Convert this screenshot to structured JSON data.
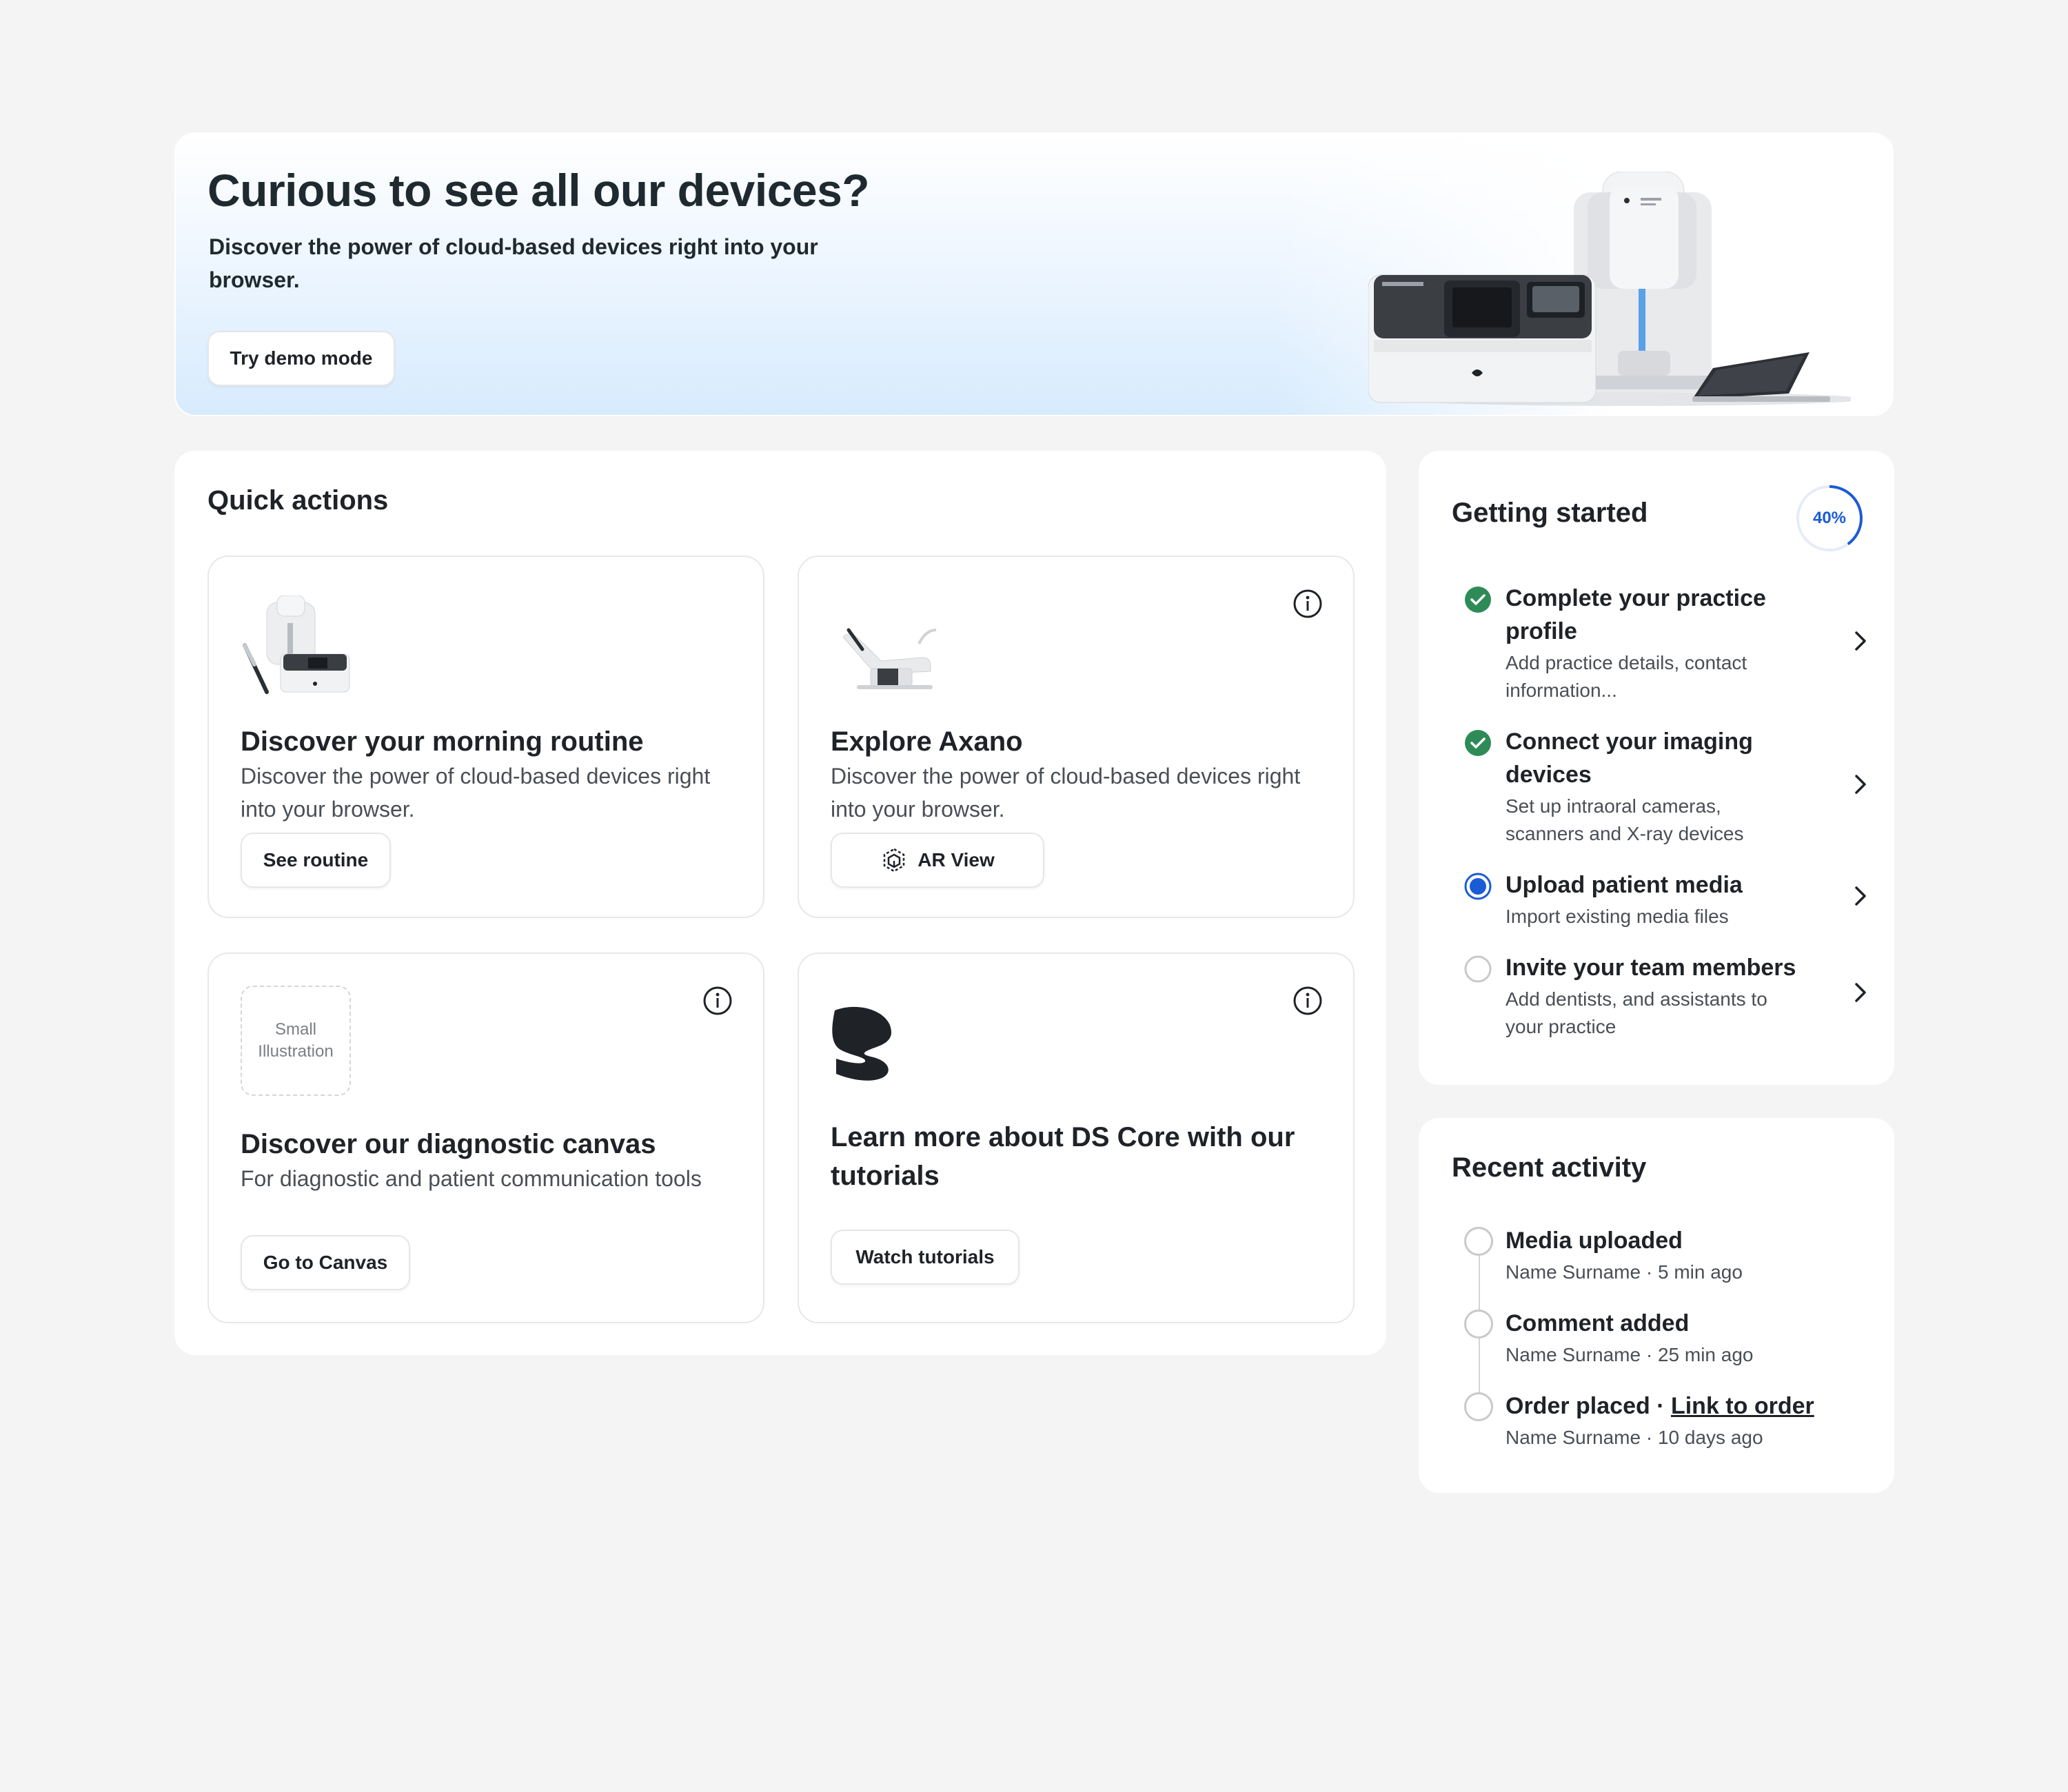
{
  "hero": {
    "title": "Curious to see all our devices?",
    "subtitle": "Discover the power of cloud-based devices right into your browser.",
    "button": "Try demo mode"
  },
  "quick_actions": {
    "title": "Quick actions",
    "tiles": [
      {
        "title": "Discover your morning routine",
        "description": "Discover the power of cloud-based devices right into your browser.",
        "button": "See routine"
      },
      {
        "title": "Explore Axano",
        "description": "Discover the power of cloud-based devices right into your browser.",
        "button": "AR View"
      },
      {
        "title": "Discover our diagnostic canvas",
        "description": "For diagnostic and patient communication tools",
        "button": "Go to Canvas",
        "placeholder_line1": "Small",
        "placeholder_line2": "Illustration"
      },
      {
        "title": "Learn more about DS Core with our tutorials",
        "button": "Watch tutorials"
      }
    ]
  },
  "getting_started": {
    "title": "Getting started",
    "progress_label": "40%",
    "progress_value": 0.4,
    "steps": [
      {
        "title": "Complete your practice profile",
        "description": "Add practice details, contact information...",
        "status": "done"
      },
      {
        "title": "Connect your imaging devices",
        "description": "Set up intraoral cameras, scanners and X-ray devices",
        "status": "done"
      },
      {
        "title": "Upload patient media",
        "description": "Import existing media files",
        "status": "current"
      },
      {
        "title": "Invite your team members",
        "description": "Add dentists, and assistants to your practice",
        "status": "todo"
      }
    ]
  },
  "recent_activity": {
    "title": "Recent activity",
    "items": [
      {
        "title": "Media uploaded",
        "meta": "Name Surname · 5 min ago"
      },
      {
        "title": "Comment added",
        "meta": "Name Surname · 25 min ago"
      },
      {
        "title": "Order placed · ",
        "link": "Link to order",
        "meta": "Name Surname · 10 days ago"
      }
    ]
  },
  "colors": {
    "accent": "#1b5bd6",
    "success": "#2e8b57",
    "background": "#f4f4f4"
  }
}
